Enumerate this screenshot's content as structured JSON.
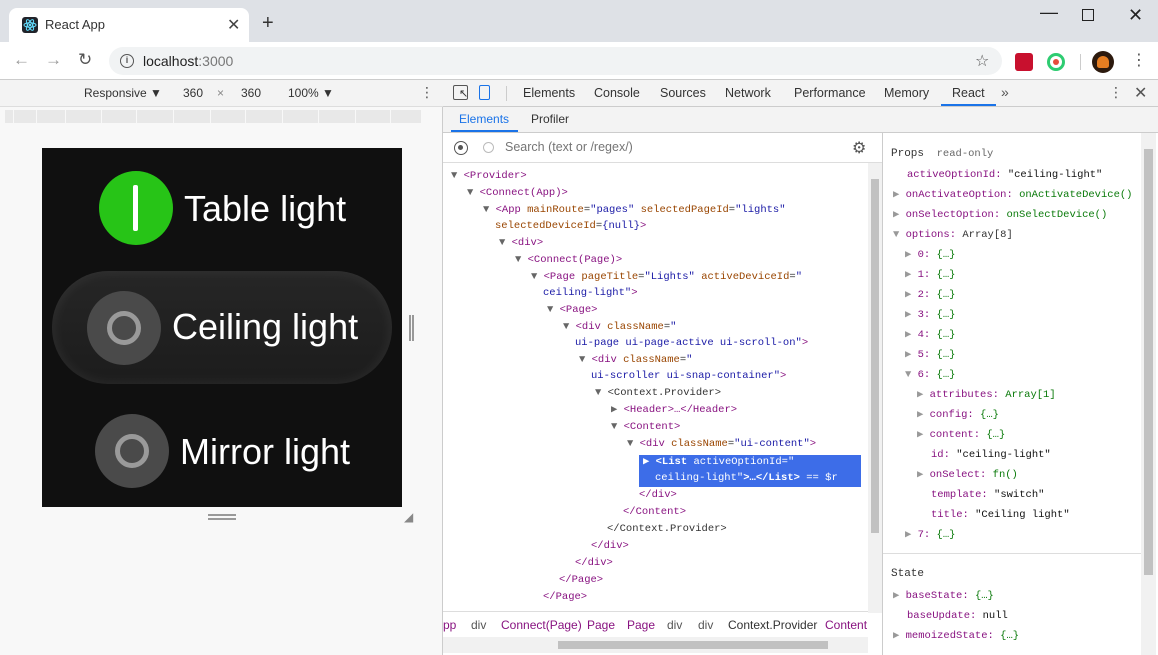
{
  "browser": {
    "tab_title": "React App",
    "url_host": "localhost",
    "url_port": ":3000"
  },
  "device_toolbar": {
    "mode": "Responsive ▼",
    "width": "360",
    "x": "×",
    "height": "360",
    "zoom": "100% ▼"
  },
  "app": {
    "items": [
      {
        "label": "Table light",
        "state": "on"
      },
      {
        "label": "Ceiling light",
        "state": "off",
        "active": true
      },
      {
        "label": "Mirror light",
        "state": "off"
      }
    ]
  },
  "devtools": {
    "tabs": [
      "Elements",
      "Console",
      "Sources",
      "Network",
      "Performance",
      "Memory",
      "React"
    ],
    "active_tab": "React",
    "react_tabs": [
      "Elements",
      "Profiler"
    ],
    "search_placeholder": "Search (text or /regex/)",
    "breadcrumbs": [
      "pp",
      "div",
      "Connect(Page)",
      "Page",
      "Page",
      "div",
      "div",
      "Context.Provider",
      "Content"
    ]
  },
  "props_panel": {
    "props_title": "Props",
    "props_sub": "read-only",
    "state_title": "State",
    "state_items": [
      {
        "key": "baseState:",
        "val": "{…}"
      },
      {
        "key": "baseUpdate:",
        "val": "null"
      },
      {
        "key": "memoizedState:",
        "val": "{…}"
      }
    ]
  },
  "colors": {
    "accent": "#1a73e8",
    "switch_on": "#27c417",
    "selection": "#3d6de8",
    "tag": "#881280",
    "attr": "#994500",
    "value": "#1a1aa6"
  }
}
